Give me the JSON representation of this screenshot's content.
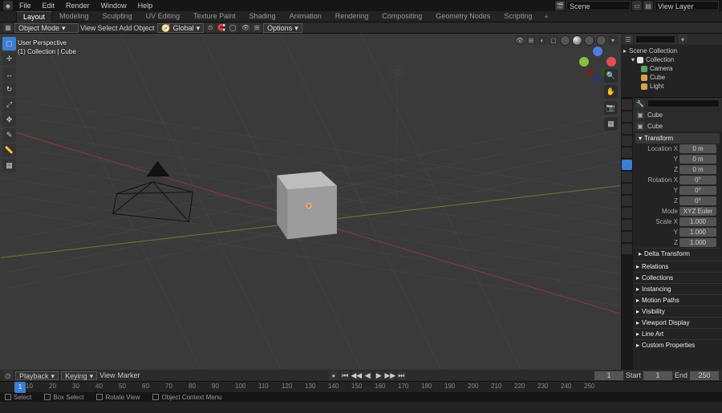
{
  "topmenu": [
    "File",
    "Edit",
    "Render",
    "Window",
    "Help"
  ],
  "scene_label": "Scene",
  "viewlayer_label": "View Layer",
  "workspaces": [
    "Layout",
    "Modeling",
    "Sculpting",
    "UV Editing",
    "Texture Paint",
    "Shading",
    "Animation",
    "Rendering",
    "Compositing",
    "Geometry Nodes",
    "Scripting"
  ],
  "active_workspace": 0,
  "vp_header": {
    "mode": "Object Mode",
    "menus": [
      "View",
      "Select",
      "Add",
      "Object"
    ],
    "orientation": "Global",
    "options_label": "Options"
  },
  "vp_info": {
    "line1": "User Perspective",
    "line2": "(1) Collection | Cube"
  },
  "left_tools": [
    "cursor",
    "select",
    "move",
    "rotate",
    "scale",
    "transform",
    "annotate",
    "measure",
    "add"
  ],
  "right_tools": [
    "zoom",
    "pan",
    "camera",
    "perspective",
    "layers"
  ],
  "outliner": {
    "root": "Scene Collection",
    "collection": "Collection",
    "items": [
      {
        "name": "Camera",
        "color": "#5aa06a"
      },
      {
        "name": "Cube",
        "color": "#d8a24a"
      },
      {
        "name": "Light",
        "color": "#d8a24a"
      }
    ]
  },
  "props": {
    "context": "Cube",
    "data": "Cube",
    "transform_label": "Transform",
    "loc_label": "Location X",
    "loc": [
      "0 m",
      "0 m",
      "0 m"
    ],
    "rot_label": "Rotation X",
    "rot": [
      "0°",
      "0°",
      "0°"
    ],
    "mode_label": "Mode",
    "mode_val": "XYZ Euler",
    "scale_label": "Scale X",
    "scale": [
      "1.000",
      "1.000",
      "1.000"
    ],
    "delta": "Delta Transform",
    "panels": [
      "Relations",
      "Collections",
      "Instancing",
      "Motion Paths",
      "Visibility",
      "Viewport Display",
      "Line Art",
      "Custom Properties"
    ]
  },
  "timeline": {
    "menus": [
      "Playback",
      "Keying",
      "View",
      "Marker"
    ],
    "current": "1",
    "start_lab": "Start",
    "start": "1",
    "end_lab": "End",
    "end": "250",
    "ticks": [
      10,
      20,
      30,
      40,
      50,
      60,
      70,
      80,
      90,
      100,
      110,
      120,
      130,
      140,
      150,
      160,
      170,
      180,
      190,
      200,
      210,
      220,
      230,
      240,
      250
    ]
  },
  "status": {
    "select": "Select",
    "box": "Box Select",
    "rotate": "Rotate View",
    "menu": "Object Context Menu"
  }
}
